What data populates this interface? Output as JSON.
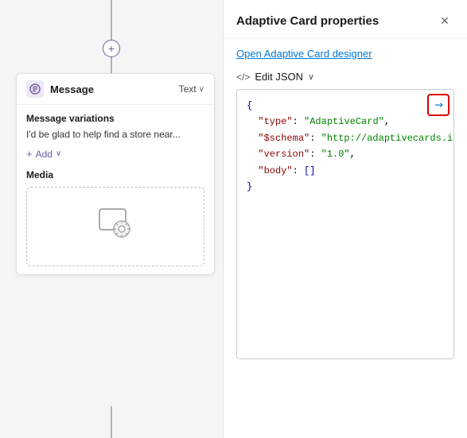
{
  "canvas": {
    "plus_button_label": "+",
    "message_card": {
      "title": "Message",
      "text_badge": "Text",
      "text_badge_chevron": "∨",
      "variations_label": "Message variations",
      "variation_text": "I'd be glad to help find a store near...",
      "add_label": "+ Add",
      "add_chevron": "∨",
      "media_label": "Media"
    }
  },
  "properties_panel": {
    "title": "Adaptive Card properties",
    "close_label": "✕",
    "open_designer_link": "Open Adaptive Card designer",
    "edit_json_icon": "</>",
    "edit_json_label": "Edit JSON",
    "edit_json_chevron": "∨",
    "json_content": {
      "line1": "{",
      "line2": "  \"type\": \"AdaptiveCard\",",
      "line3": "  \"$schema\": \"http://adaptivecards.i",
      "line4": "  \"version\": \"1.0\",",
      "line5": "  \"body\": []",
      "line6": "}"
    },
    "expand_icon": "↗"
  }
}
